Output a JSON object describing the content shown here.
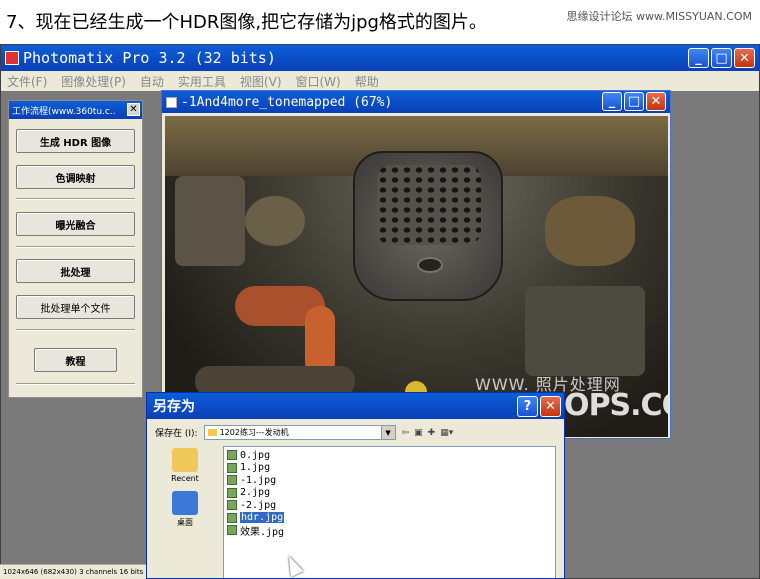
{
  "caption": "7、现在已经生成一个HDR图像,把它存储为jpg格式的图片。",
  "watermark": "思缘设计论坛 www.MISSYUAN.COM",
  "app": {
    "title": "Photomatix Pro 3.2 (32 bits)",
    "menu": [
      "文件(F)",
      "图像处理(P)",
      "自动",
      "实用工具",
      "视图(V)",
      "窗口(W)",
      "帮助"
    ],
    "window_buttons": {
      "minimize": "_",
      "maximize": "□",
      "close": "✕"
    }
  },
  "workflow": {
    "title": "工作流程(www.360tu.c..",
    "close": "✕",
    "buttons": [
      "生成 HDR 图像",
      "色调映射",
      "曝光融合",
      "批处理",
      "批处理单个文件",
      "教程"
    ]
  },
  "image_window": {
    "title": "-1And4more_tonemapped (67%)",
    "watermark_small": "WWW.  照片处理网",
    "watermark_large": "PHOTOPS.COM"
  },
  "save_dialog": {
    "title": "另存为",
    "help": "?",
    "close": "✕",
    "save_in_label": "保存在 (I):",
    "save_in_value": "1202练习---发动机",
    "places": [
      {
        "label": "Recent",
        "icon": "recent-folder-icon"
      },
      {
        "label": "桌面",
        "icon": "desktop-icon"
      }
    ],
    "files": [
      "0.jpg",
      "1.jpg",
      "-1.jpg",
      "2.jpg",
      "-2.jpg",
      "hdr.jpg",
      "效果.jpg"
    ],
    "selected_file": "hdr.jpg"
  },
  "statusbar": "1024x646 (682x430) 3 channels 16 bits",
  "colors": {
    "titlebar": "#0a3fb6",
    "dialog_bg": "#ece9d8",
    "selection": "#316ac5",
    "workspace": "#7a7a7a"
  }
}
